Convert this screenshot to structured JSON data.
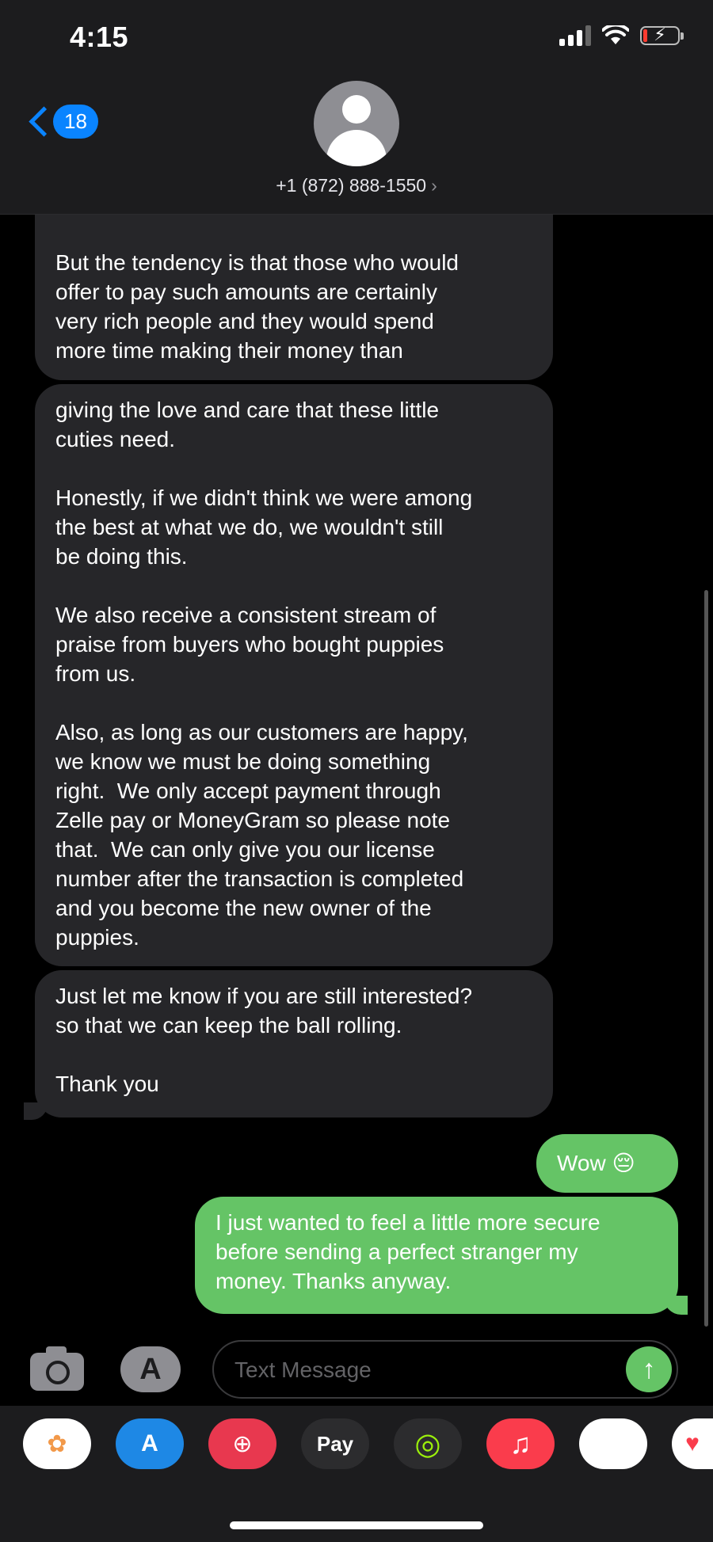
{
  "status_bar": {
    "time": "4:15"
  },
  "header": {
    "back_badge": "18",
    "contact": "+1 (872) 888-1550",
    "caret": "›"
  },
  "messages": [
    {
      "from": "them",
      "text": "But the tendency is that those who would\noffer to pay such amounts are certainly\nvery rich people and they would spend\nmore time making their money than"
    },
    {
      "from": "them",
      "text": "giving the love and care that these little\ncuties need.\n\nHonestly, if we didn't think we were among\nthe best at what we do, we wouldn't still\nbe doing this.\n\nWe also receive a consistent stream of\npraise from buyers who bought puppies\nfrom us.\n\nAlso, as long as our customers are happy,\nwe know we must be doing something\nright.  We only accept payment through\nZelle pay or MoneyGram so please note\nthat.  We can only give you our license\nnumber after the transaction is completed\nand you become the new owner of the\npuppies."
    },
    {
      "from": "them",
      "text": "Just let me know if you are still interested?\nso that we can keep the ball rolling.\n\nThank you"
    },
    {
      "from": "me",
      "text": "Wow 😔"
    },
    {
      "from": "me",
      "text": "I just wanted to feel a little more secure\nbefore sending a perfect stranger my\nmoney. Thanks anyway."
    }
  ],
  "composer": {
    "placeholder": "Text Message",
    "send_glyph": "↑",
    "appstore_glyph": "A"
  },
  "app_drawer": [
    {
      "name": "photos",
      "glyph": "✿",
      "bg": "#ffffff"
    },
    {
      "name": "app-store",
      "glyph": "A",
      "bg": "#1e88e5"
    },
    {
      "name": "image-search",
      "glyph": "⊕",
      "bg": "#e8384f"
    },
    {
      "name": "apple-pay",
      "glyph": "Pay",
      "bg": "#2c2c2e"
    },
    {
      "name": "activity",
      "glyph": "◎",
      "bg": "#2c2c2e"
    },
    {
      "name": "music",
      "glyph": "♫",
      "bg": "#fa3c4c"
    },
    {
      "name": "memoji",
      "glyph": "😎",
      "bg": "#ffffff"
    },
    {
      "name": "digital-touch",
      "glyph": "♥",
      "bg": "#ffffff"
    }
  ],
  "colors": {
    "blue": "#0a84ff",
    "green_bubble": "#65c466",
    "gray_bubble": "#262629"
  }
}
